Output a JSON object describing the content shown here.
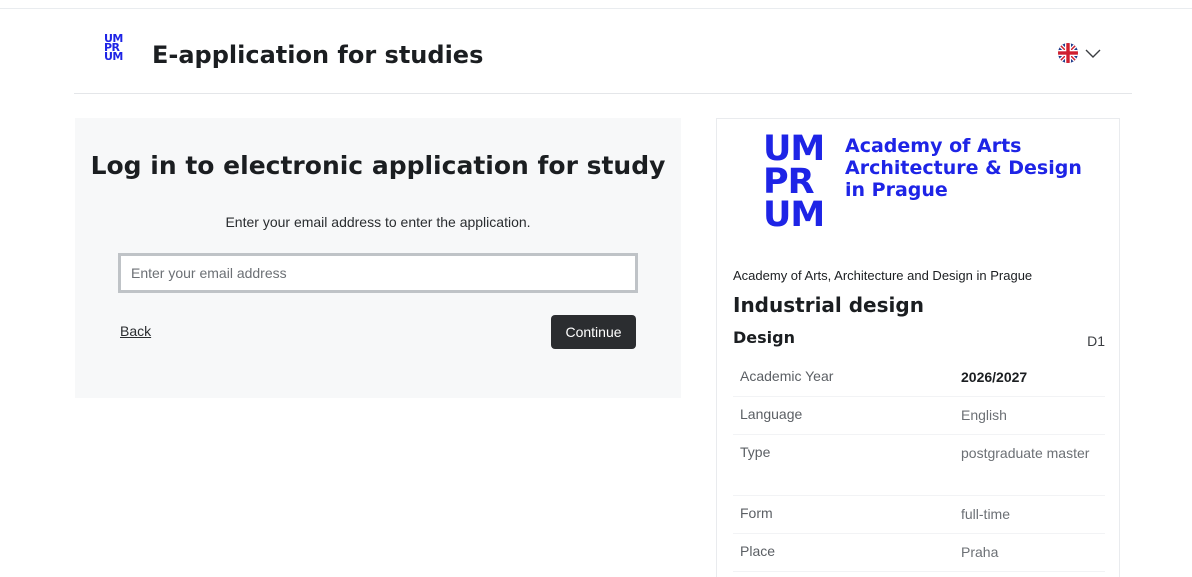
{
  "header": {
    "logo_lines": [
      "UM",
      "PR",
      "UM"
    ],
    "title_bold": "E-application",
    "title_rest": " for studies",
    "language_icon": "uk-flag-icon",
    "language_chevron": "chevron-down-icon"
  },
  "login": {
    "title": "Log in to electronic application for study",
    "subtitle": "Enter your email address to enter the application.",
    "email_placeholder": "Enter your email address",
    "email_value": "",
    "back_label": "Back",
    "continue_label": "Continue"
  },
  "program": {
    "logo_mark": [
      "UM",
      "PR",
      "UM"
    ],
    "logo_name": [
      "Academy of Arts",
      "Architecture & Design",
      "in Prague"
    ],
    "school": "Academy of Arts, Architecture and Design in Prague",
    "name": "Industrial design",
    "field": "Design",
    "code": "D1",
    "info": [
      {
        "label": "Academic Year",
        "value": "2026/2027"
      },
      {
        "label": "Language",
        "value": "English"
      },
      {
        "label": "Type",
        "value": "postgraduate master"
      },
      {
        "label": "Form",
        "value": "full-time"
      },
      {
        "label": "Place",
        "value": "Praha"
      }
    ]
  },
  "colors": {
    "brand_blue": "#1e24e6",
    "button_dark": "#2b2d30",
    "card_bg": "#f7f8f9"
  }
}
